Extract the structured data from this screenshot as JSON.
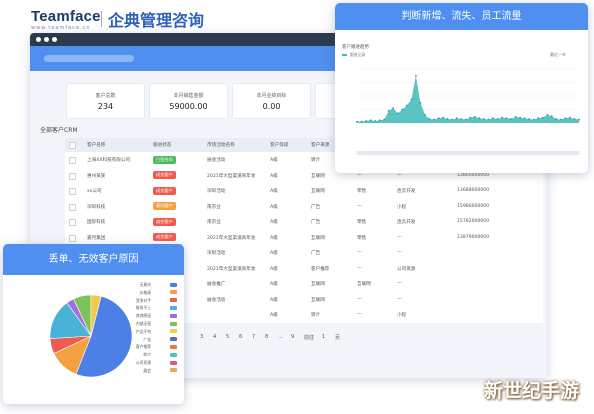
{
  "brand": {
    "logo": "Teamface",
    "logo_sub": "www.teamface.cn",
    "title": "企典管理咨询"
  },
  "stats": [
    {
      "label": "客户总数",
      "value": "234"
    },
    {
      "label": "本月销售金额",
      "value": "59000.00"
    },
    {
      "label": "本月业绩目标",
      "value": "0.00"
    },
    {
      "label": "",
      "value": ""
    }
  ],
  "table": {
    "title": "全部客户CRM",
    "headers": [
      "客户名称",
      "跟进状态",
      "市场活动名称",
      "客户等级",
      "客户来源",
      "",
      "",
      ""
    ],
    "rows": [
      {
        "name": "上海XX科技有限公司",
        "status": "已签合同",
        "status_color": "#4cbb5c",
        "activity": "展会活动",
        "level": "A级",
        "source": "转介",
        "c6": "",
        "c7": "",
        "c8": ""
      },
      {
        "name": "惠州某某",
        "status": "成交客户",
        "status_color": "#f05b4f",
        "activity": "2021年大型渠道商年会",
        "level": "A级",
        "source": "互联网",
        "c6": "—",
        "c7": "—",
        "c8": "13800000000"
      },
      {
        "name": "xx公司",
        "status": "成交客户",
        "status_color": "#f05b4f",
        "activity": "深圳活动",
        "level": "A级",
        "source": "互联网",
        "c6": "零售",
        "c7": "连云开发",
        "c8": "13688000000"
      },
      {
        "name": "深圳科技",
        "status": "意向客户",
        "status_color": "#f5a142",
        "activity": "南京业",
        "level": "A级",
        "source": "广告",
        "c6": "—",
        "c7": "小程",
        "c8": "15986000000"
      },
      {
        "name": "国际科技",
        "status": "成交客户",
        "status_color": "#f05b4f",
        "activity": "南京业",
        "level": "A级",
        "source": "广告",
        "c6": "零售",
        "c7": "连云开发",
        "c8": "15782000000"
      },
      {
        "name": "嘉月集团",
        "status": "成交客户",
        "status_color": "#f05b4f",
        "activity": "2021年大型渠道商年会",
        "level": "A级",
        "source": "互联网",
        "c6": "零售",
        "c7": "—",
        "c8": "13879000000"
      },
      {
        "name": "",
        "status": "",
        "status_color": "",
        "activity": "深圳活动",
        "level": "A级",
        "source": "广告",
        "c6": "—",
        "c7": "—",
        "c8": ""
      },
      {
        "name": "",
        "status": "",
        "status_color": "",
        "activity": "2021年大型渠道商年会",
        "level": "A级",
        "source": "客户推荐",
        "c6": "—",
        "c7": "公司资源",
        "c8": ""
      },
      {
        "name": "",
        "status": "",
        "status_color": "",
        "activity": "展会推广",
        "level": "A级",
        "source": "互联网",
        "c6": "互联网",
        "c7": "—",
        "c8": ""
      },
      {
        "name": "",
        "status": "",
        "status_color": "",
        "activity": "展会活动",
        "level": "A级",
        "source": "互联网",
        "c6": "—",
        "c7": "—",
        "c8": ""
      },
      {
        "name": "",
        "status": "",
        "status_color": "",
        "activity": "",
        "level": "A级",
        "source": "转介",
        "c6": "—",
        "c7": "小程",
        "c8": ""
      }
    ],
    "pager": [
      "3",
      "4",
      "5",
      "6",
      "7",
      "8",
      "…",
      "9",
      "前往",
      "1",
      "页"
    ]
  },
  "trend_panel": {
    "title": "判断新增、流失、员工流量",
    "subtitle": "客户跟进趋势",
    "legend": "跟进记录",
    "range": "最近一年"
  },
  "pie_panel": {
    "title": "丢单、无效客户原因",
    "legend": [
      {
        "label": "无意向",
        "color": "#4e7fe6"
      },
      {
        "label": "价格高",
        "color": "#f5a142"
      },
      {
        "label": "竞争对手",
        "color": "#f05b4f"
      },
      {
        "label": "联系不上",
        "color": "#48b3d9"
      },
      {
        "label": "其他原因",
        "color": "#a06ee0"
      },
      {
        "label": "内部无权",
        "color": "#7dc25a"
      },
      {
        "label": "产品不符",
        "color": "#f2c94c"
      },
      {
        "label": "广告",
        "color": "#5b6ec2"
      },
      {
        "label": "客户推荐",
        "color": "#e8794c"
      },
      {
        "label": "转介",
        "color": "#4ec3b6"
      },
      {
        "label": "公司资源",
        "color": "#d95b8a"
      },
      {
        "label": "展会",
        "color": "#f0a35b"
      }
    ]
  },
  "chart_data": [
    {
      "type": "area",
      "title": "客户跟进趋势",
      "series": [
        {
          "name": "跟进记录",
          "values": [
            2,
            2,
            3,
            4,
            3,
            4,
            5,
            18,
            22,
            14,
            20,
            26,
            35,
            70,
            30,
            12,
            6,
            5,
            7,
            8,
            6,
            5,
            7,
            6,
            5,
            8,
            9,
            7,
            6,
            5,
            7,
            6,
            8,
            7,
            6,
            9,
            8,
            7,
            6,
            5,
            7,
            8,
            12,
            10,
            6,
            5,
            7,
            8,
            6,
            5
          ]
        }
      ],
      "ylim": [
        0,
        80
      ]
    },
    {
      "type": "pie",
      "values": [
        52,
        12,
        6,
        16,
        3,
        7,
        4
      ],
      "labels": [
        "无意向",
        "价格高",
        "竞争对手",
        "联系不上",
        "其他原因",
        "内部无权",
        "产品不符"
      ]
    }
  ],
  "watermark": "新世纪手游",
  "colors": {
    "accent": "#4e8ff0",
    "dark_bar": "#2c3a4d",
    "teal": "#3fb9b9"
  }
}
